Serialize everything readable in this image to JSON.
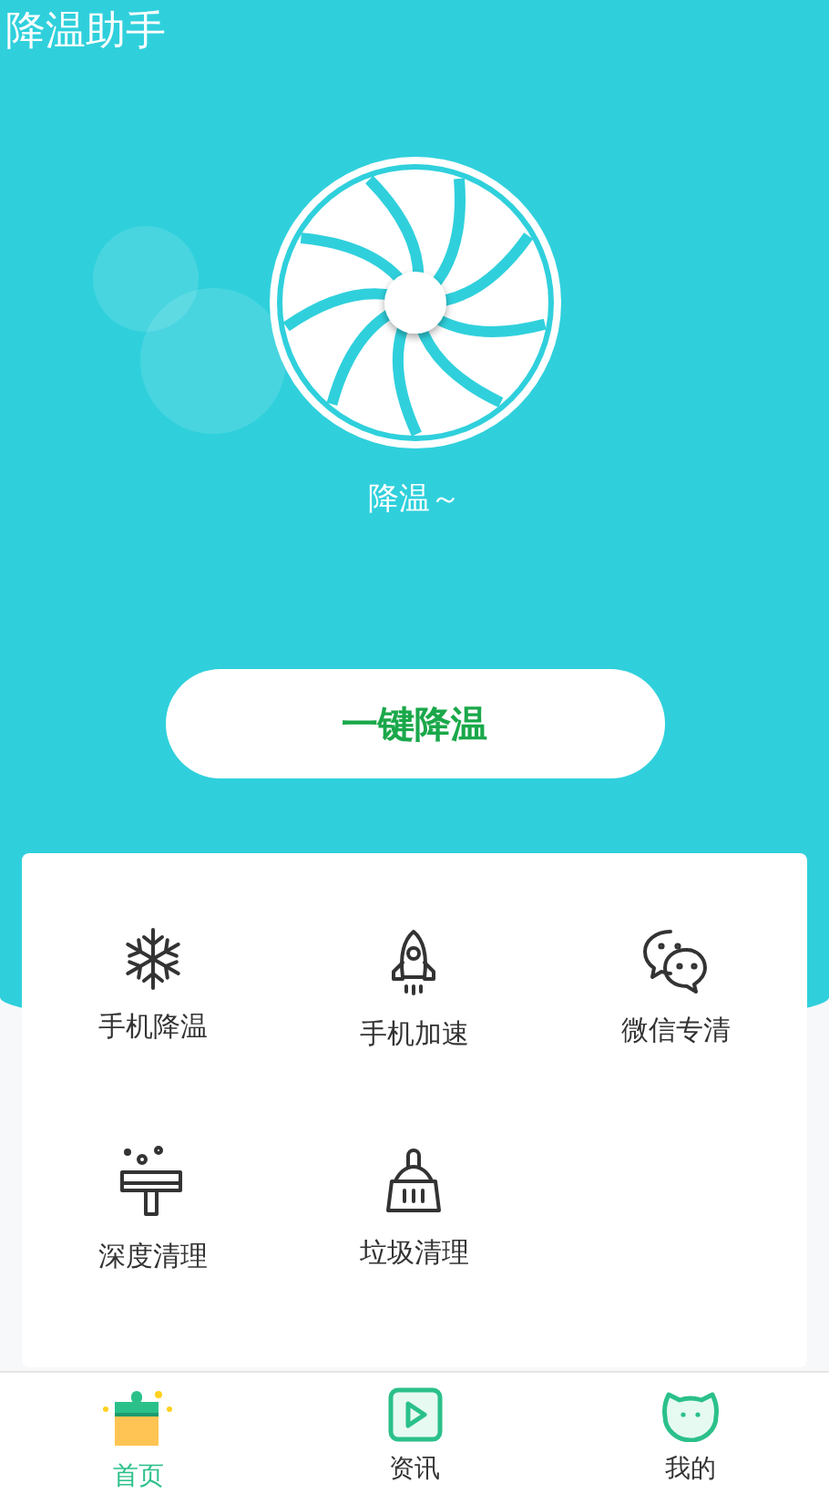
{
  "app_title": "降温助手",
  "fan_caption": "降温～",
  "cool_button": "一键降温",
  "features": [
    {
      "kind": "snowflake",
      "label": "手机降温"
    },
    {
      "kind": "rocket",
      "label": "手机加速"
    },
    {
      "kind": "chat",
      "label": "微信专清"
    },
    {
      "kind": "squeegee",
      "label": "深度清理"
    },
    {
      "kind": "brush",
      "label": "垃圾清理"
    }
  ],
  "tabs": [
    {
      "kind": "home",
      "label": "首页",
      "selected": true
    },
    {
      "kind": "video",
      "label": "资讯",
      "selected": false
    },
    {
      "kind": "face",
      "label": "我的",
      "selected": false
    }
  ]
}
